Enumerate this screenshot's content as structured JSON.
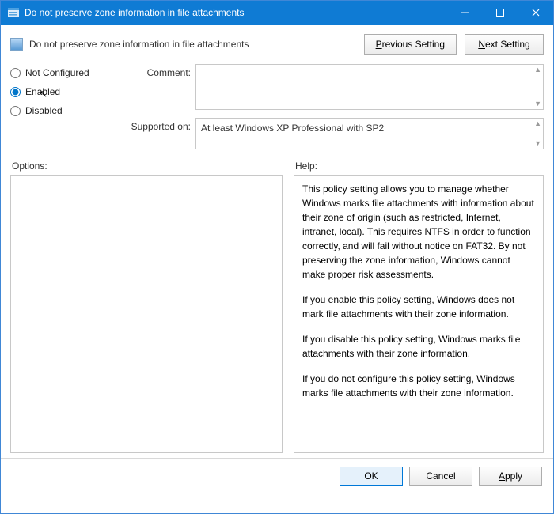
{
  "window": {
    "title": "Do not preserve zone information in file attachments"
  },
  "header": {
    "title": "Do not preserve zone information in file attachments",
    "previous_setting_label": "Previous Setting",
    "next_setting_label": "Next Setting",
    "prev_mnemonic": "P",
    "next_mnemonic": "N"
  },
  "radios": {
    "not_configured": {
      "label": "Not ",
      "mnemonic": "C",
      "rest": "onfigured",
      "checked": false
    },
    "enabled": {
      "label": "",
      "mnemonic": "E",
      "rest": "nabled",
      "checked": true
    },
    "disabled": {
      "label": "",
      "mnemonic": "D",
      "rest": "isabled",
      "checked": false
    }
  },
  "fields": {
    "comment_label": "Comment:",
    "comment_value": "",
    "supported_label": "Supported on:",
    "supported_value": "At least Windows XP Professional with SP2"
  },
  "panels": {
    "options_label": "Options:",
    "help_label": "Help:",
    "help_paragraphs": [
      "This policy setting allows you to manage whether Windows marks file attachments with information about their zone of origin (such as restricted, Internet, intranet, local). This requires NTFS in order to function correctly, and will fail without notice on FAT32. By not preserving the zone information, Windows cannot make proper risk assessments.",
      "If you enable this policy setting, Windows does not mark file attachments with their zone information.",
      "If you disable this policy setting, Windows marks file attachments with their zone information.",
      "If you do not configure this policy setting, Windows marks file attachments with their zone information."
    ]
  },
  "footer": {
    "ok": "OK",
    "cancel": "Cancel",
    "apply": "Apply",
    "apply_mnemonic": "A"
  }
}
